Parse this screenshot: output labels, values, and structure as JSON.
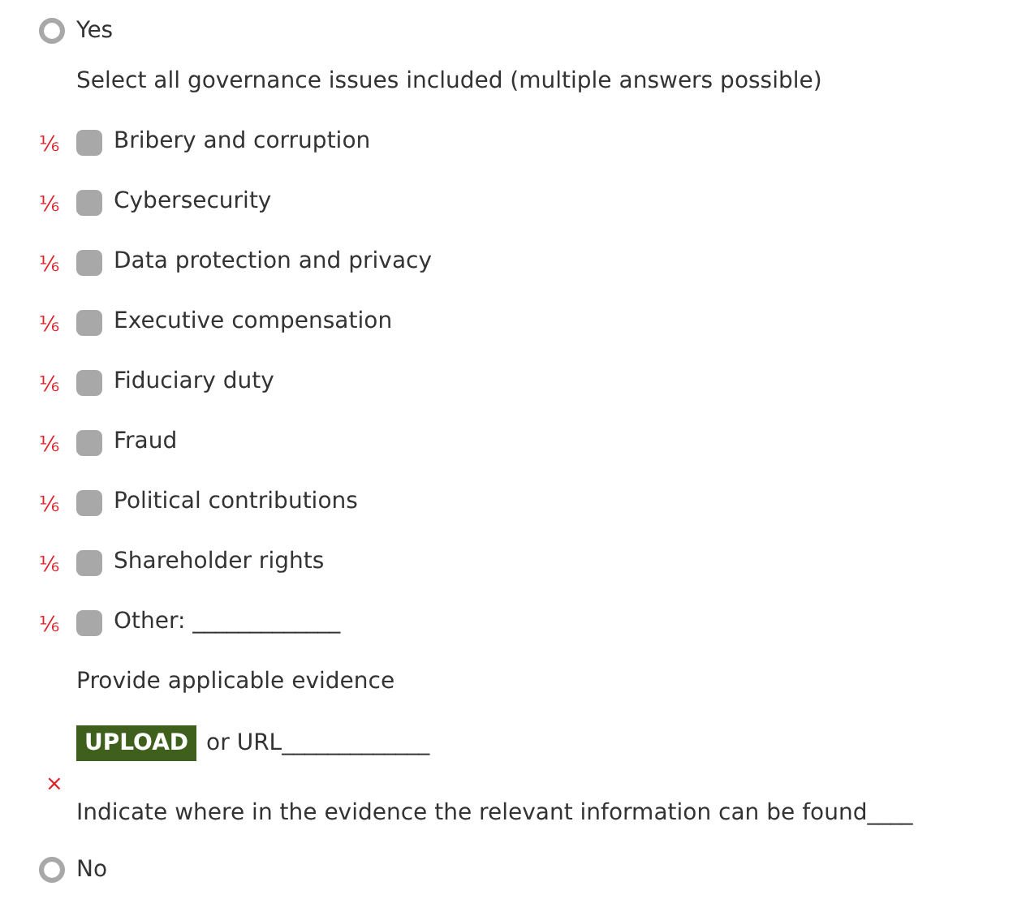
{
  "options": [
    {
      "label": "Yes",
      "selected": false,
      "kind": "expanded"
    },
    {
      "label": "No",
      "selected": false,
      "kind": "plain"
    }
  ],
  "instruction": "Select all governance issues included (multiple answers possible)",
  "issues": [
    {
      "score": "⅙",
      "label": "Bribery and corruption",
      "checked": false
    },
    {
      "score": "⅙",
      "label": "Cybersecurity",
      "checked": false
    },
    {
      "score": "⅙",
      "label": "Data protection and privacy",
      "checked": false
    },
    {
      "score": "⅙",
      "label": "Executive compensation",
      "checked": false
    },
    {
      "score": "⅙",
      "label": "Fiduciary duty",
      "checked": false
    },
    {
      "score": "⅙",
      "label": "Fraud",
      "checked": false
    },
    {
      "score": "⅙",
      "label": "Political contributions",
      "checked": false
    },
    {
      "score": "⅙",
      "label": "Shareholder rights",
      "checked": false
    },
    {
      "score": "⅙",
      "label": "Other: _____________",
      "checked": false
    }
  ],
  "evidence_prompt": "Provide applicable evidence",
  "upload_button": "UPLOAD",
  "url_label": "or URL_____________",
  "error_mark": "×",
  "location_prompt": "Indicate where in the evidence the relevant information can be found____"
}
